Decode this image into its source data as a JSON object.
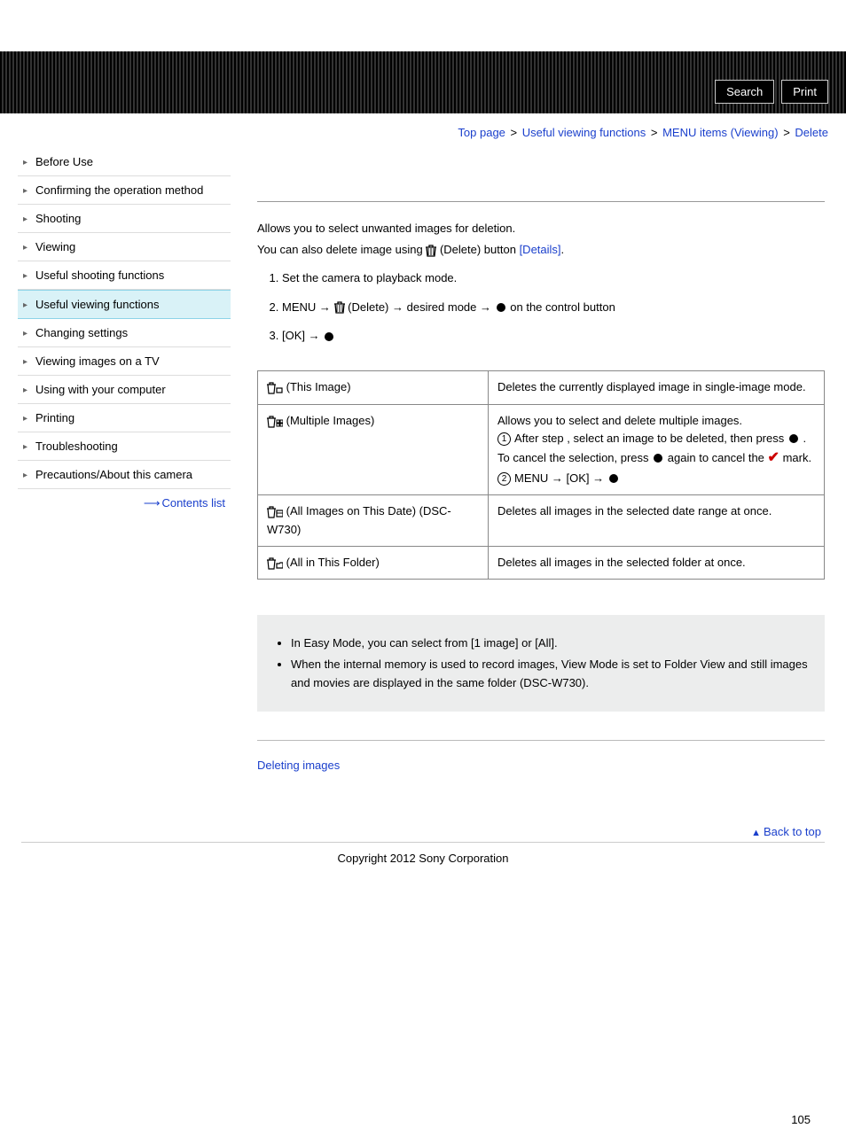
{
  "header": {
    "search_label": "Search",
    "print_label": "Print"
  },
  "breadcrumb": {
    "items": [
      "Top page",
      "Useful viewing functions",
      "MENU items (Viewing)",
      "Delete"
    ],
    "sep": ">"
  },
  "sidebar": {
    "items": [
      {
        "label": "Before Use"
      },
      {
        "label": "Confirming the operation method"
      },
      {
        "label": "Shooting"
      },
      {
        "label": "Viewing"
      },
      {
        "label": "Useful shooting functions"
      },
      {
        "label": "Useful viewing functions",
        "active": true
      },
      {
        "label": "Changing settings"
      },
      {
        "label": "Viewing images on a TV"
      },
      {
        "label": "Using with your computer"
      },
      {
        "label": "Printing"
      },
      {
        "label": "Troubleshooting"
      },
      {
        "label": "Precautions/About this camera"
      }
    ],
    "contents_label": "Contents list"
  },
  "main": {
    "intro_line1": "Allows you to select unwanted images for deletion.",
    "intro_line2_pre": "You can also delete image using ",
    "intro_line2_mid": " (Delete) button ",
    "intro_line2_link": "[Details]",
    "intro_line2_post": ".",
    "step1": "Set the camera to playback mode.",
    "step2_pre": "MENU ",
    "step2_delete": " (Delete) ",
    "step2_mid": " desired mode ",
    "step2_post": " on the control button",
    "step3_pre": "[OK] ",
    "table": [
      {
        "mode": " (This Image)",
        "desc_plain": "Deletes the currently displayed image in single-image mode."
      },
      {
        "mode": " (Multiple Images)",
        "desc_html": true,
        "d_line1": "Allows you to select and delete multiple images.",
        "d_step1_pre": "After step ",
        "d_step1_post": ", select an image to be deleted, then press ",
        "d_step1_end": " .",
        "d_cancel_pre": "To cancel the selection, press ",
        "d_cancel_mid": " again to cancel the ",
        "d_cancel_post": " mark.",
        "d_step2_pre": "MENU ",
        "d_step2_ok": " [OK] "
      },
      {
        "mode": " (All Images on This Date) (DSC-W730)",
        "desc_plain": "Deletes all images in the selected date range at once."
      },
      {
        "mode": " (All in This Folder)",
        "desc_plain": "Deletes all images in the selected folder at once."
      }
    ],
    "notes": [
      "In Easy Mode, you can select from [1 image] or [All].",
      "When the internal memory is used to record images, View Mode is set to Folder View and still images and movies are displayed in the same folder (DSC-W730)."
    ],
    "related_link": "Deleting images",
    "back_to_top": "Back to top"
  },
  "footer": {
    "copyright": "Copyright 2012 Sony Corporation",
    "page_number": "105"
  }
}
